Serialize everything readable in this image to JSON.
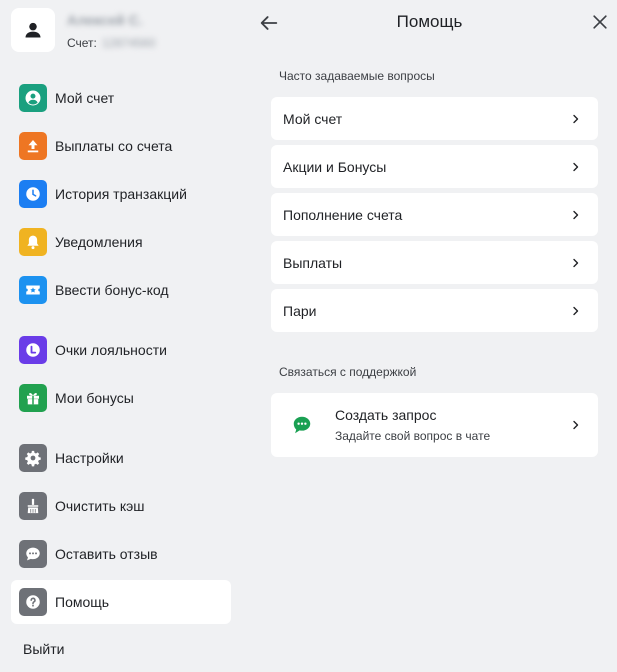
{
  "profile": {
    "name": "Алексей С.",
    "account_label": "Счет:",
    "account_number": "12874560"
  },
  "sidebar": {
    "items": [
      {
        "label": "Мой счет",
        "icon": "account-circle-icon",
        "color": "#1aa07f"
      },
      {
        "label": "Выплаты со счета",
        "icon": "upload-icon",
        "color": "#ee7623"
      },
      {
        "label": "История транзакций",
        "icon": "clock-icon",
        "color": "#1c7ef2"
      },
      {
        "label": "Уведомления",
        "icon": "bell-icon",
        "color": "#f0b321"
      },
      {
        "label": "Ввести бонус-код",
        "icon": "ticket-star-icon",
        "color": "#1c92f0"
      },
      {
        "label": "Очки лояльности",
        "icon": "loyalty-icon",
        "color": "#6a3ce8"
      },
      {
        "label": "Мои бонусы",
        "icon": "gift-icon",
        "color": "#21a14f"
      },
      {
        "label": "Настройки",
        "icon": "gear-icon",
        "color": "#6e7177"
      },
      {
        "label": "Очистить кэш",
        "icon": "broom-icon",
        "color": "#6e7177"
      },
      {
        "label": "Оставить отзыв",
        "icon": "feedback-icon",
        "color": "#6e7177"
      },
      {
        "label": "Помощь",
        "icon": "help-icon",
        "color": "#6e7177"
      }
    ],
    "logout_label": "Выйти"
  },
  "header": {
    "title": "Помощь"
  },
  "faq": {
    "title": "Часто задаваемые вопросы",
    "items": [
      {
        "label": "Мой счет"
      },
      {
        "label": "Акции и Бонусы"
      },
      {
        "label": "Пополнение счета"
      },
      {
        "label": "Выплаты"
      },
      {
        "label": "Пари"
      }
    ]
  },
  "support": {
    "title": "Связаться с поддержкой",
    "request_title": "Создать запрос",
    "request_subtitle": "Задайте свой вопрос в чате",
    "icon_color": "#1aa053"
  }
}
